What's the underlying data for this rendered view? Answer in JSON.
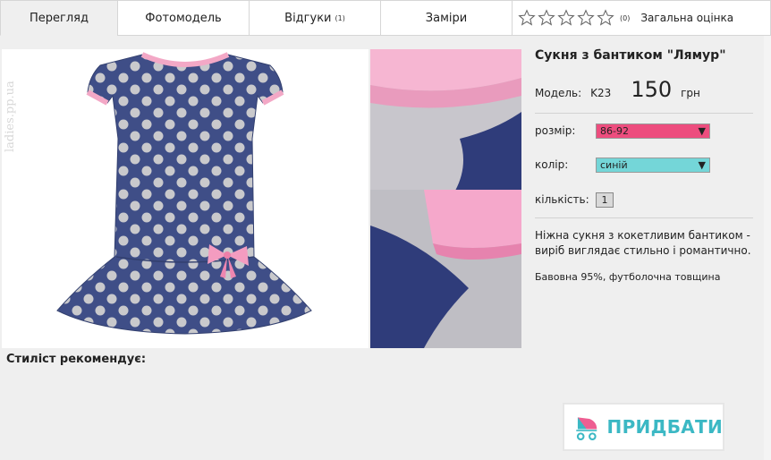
{
  "tabs": [
    {
      "label": "Перегляд"
    },
    {
      "label": "Фотомодель"
    },
    {
      "label": "Відгуки",
      "count": "(1)"
    },
    {
      "label": "Заміри"
    }
  ],
  "rating": {
    "count": "(0)",
    "label": "Загальна оцінка",
    "stars_filled": 0,
    "stars_total": 5
  },
  "watermark": "ladies.pp.ua",
  "product": {
    "title": "Сукня з бантиком \"Лямур\"",
    "model_label": "Модель:",
    "model_code": "K23",
    "price": "150",
    "currency": "грн",
    "size_label": "розмір:",
    "size_value": "86-92",
    "color_label": "колір:",
    "color_value": "синій",
    "qty_label": "кількість:",
    "qty_value": "1",
    "description": "Ніжна сукня з кокетливим бантиком - виріб виглядає стильно і романтично.",
    "composition": "Бавовна 95%, футболочна товщина"
  },
  "stylist_heading": "Стиліст рекомендує:",
  "buy_label": "ПРИДБАТИ",
  "colors": {
    "accent_pink": "#ed4d7e",
    "accent_teal": "#74d6d8",
    "buy_text": "#3bb8c4",
    "dress": "#3f4e87"
  }
}
